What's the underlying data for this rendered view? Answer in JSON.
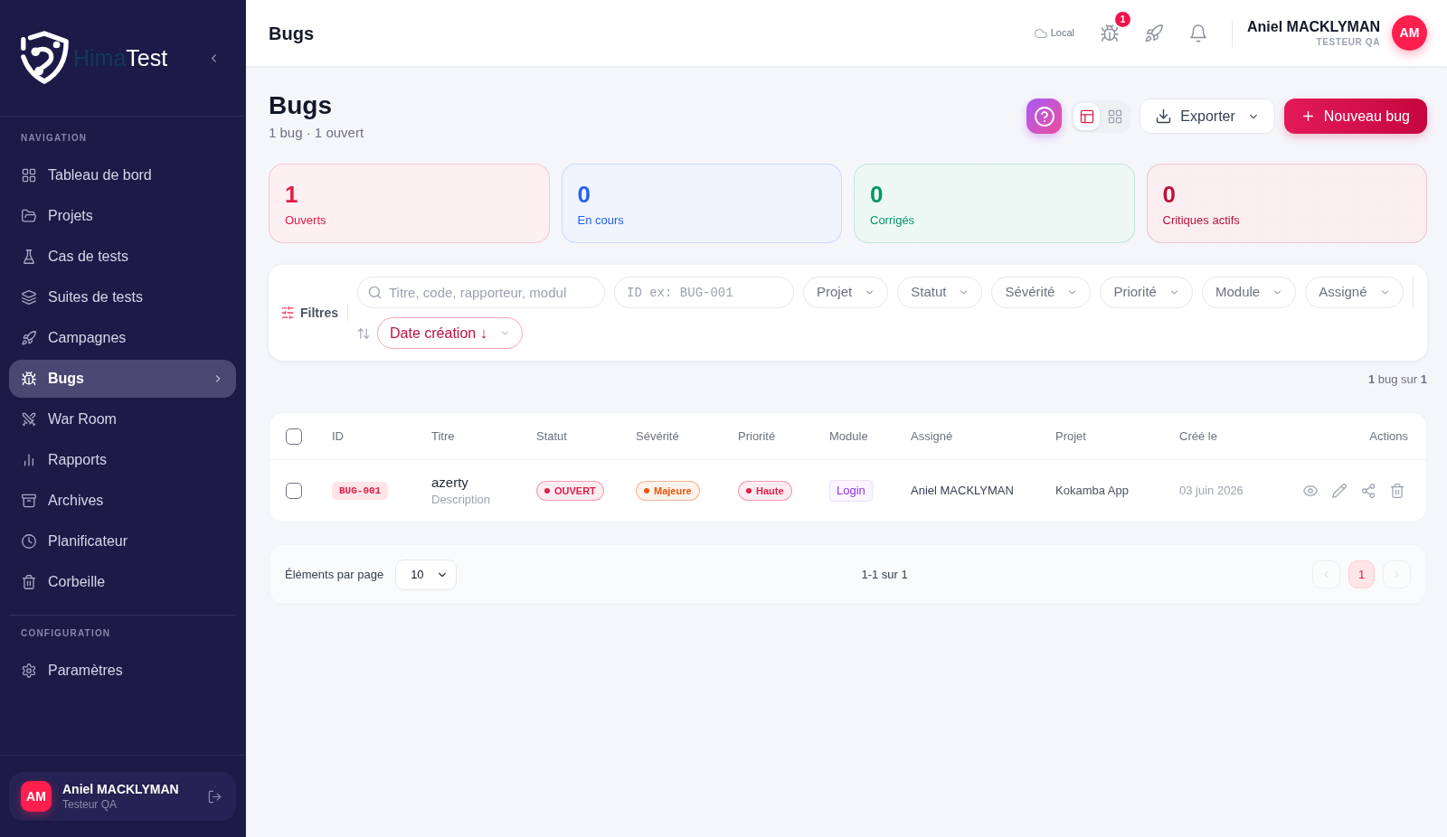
{
  "sidebar": {
    "logo": {
      "text_1": "Hima",
      "text_2": "Test"
    },
    "sections": [
      {
        "label": "NAVIGATION",
        "items": [
          {
            "label": "Tableau de bord",
            "selected": false
          },
          {
            "label": "Projets",
            "selected": false
          },
          {
            "label": "Cas de tests",
            "selected": false
          },
          {
            "label": "Suites de tests",
            "selected": false
          },
          {
            "label": "Campagnes",
            "selected": false
          },
          {
            "label": "Bugs",
            "selected": true
          },
          {
            "label": "War Room",
            "selected": false
          },
          {
            "label": "Rapports",
            "selected": false
          },
          {
            "label": "Archives",
            "selected": false
          },
          {
            "label": "Planificateur",
            "selected": false
          },
          {
            "label": "Corbeille",
            "selected": false
          }
        ]
      },
      {
        "label": "CONFIGURATION",
        "items": [
          {
            "label": "Paramètres",
            "selected": false
          }
        ]
      }
    ],
    "user": {
      "initials": "AM",
      "name": "Aniel MACKLYMAN",
      "role": "Testeur QA"
    }
  },
  "header": {
    "title": "Bugs",
    "environment": "Local",
    "notification_count": "1",
    "user": {
      "name": "Aniel MACKLYMAN",
      "role": "TESTEUR QA",
      "initials": "AM"
    }
  },
  "page": {
    "title": "Bugs",
    "subtitle": "1 bug · 1 ouvert",
    "view_modes": [
      {
        "selected": true
      },
      {
        "selected": false
      }
    ],
    "export_button": "Exporter",
    "new_button": "Nouveau bug"
  },
  "stats": [
    {
      "value": "1",
      "label": "Ouverts",
      "color": "#e11d48"
    },
    {
      "value": "0",
      "label": "En cours",
      "color": "#2563eb"
    },
    {
      "value": "0",
      "label": "Corrigés",
      "color": "#059669"
    },
    {
      "value": "0",
      "label": "Critiques actifs",
      "color": "#be123c"
    }
  ],
  "filters": {
    "label": "Filtres",
    "search": {
      "placeholder": "Titre, code, rapporteur, modul"
    },
    "id_search": {
      "placeholder": "ID ex: BUG-001"
    },
    "dropdowns": [
      "Projet",
      "Statut",
      "Sévérité",
      "Priorité",
      "Module",
      "Assigné"
    ],
    "sort": "Date création ↓"
  },
  "result_count": "**1** bug sur **1**",
  "table": {
    "select_all": {
      "checked": false
    },
    "columns": [
      "ID",
      "Titre",
      "Statut",
      "Sévérité",
      "Priorité",
      "Module",
      "Assigné",
      "Projet",
      "Créé le",
      "Actions"
    ],
    "rows": [
      {
        "checked": false,
        "id": "BUG-001",
        "title": "azerty",
        "description": "Description",
        "status": {
          "label": "OUVERT",
          "color": "#e11d48"
        },
        "severity": {
          "label": "Majeure",
          "color": "#ea580c"
        },
        "priority": {
          "label": "Haute",
          "color": "#e11d48"
        },
        "module": "Login",
        "assignee": "Aniel MACKLYMAN",
        "project": "Kokamba App",
        "created": "03 juin 2026"
      }
    ]
  },
  "pagination": {
    "per_page_label": "Éléments par page",
    "per_page": "10",
    "range": "1-1 sur 1",
    "prev": {
      "disabled": true
    },
    "next": {
      "disabled": true
    },
    "pages": [
      {
        "label": "1",
        "selected": true
      }
    ]
  }
}
